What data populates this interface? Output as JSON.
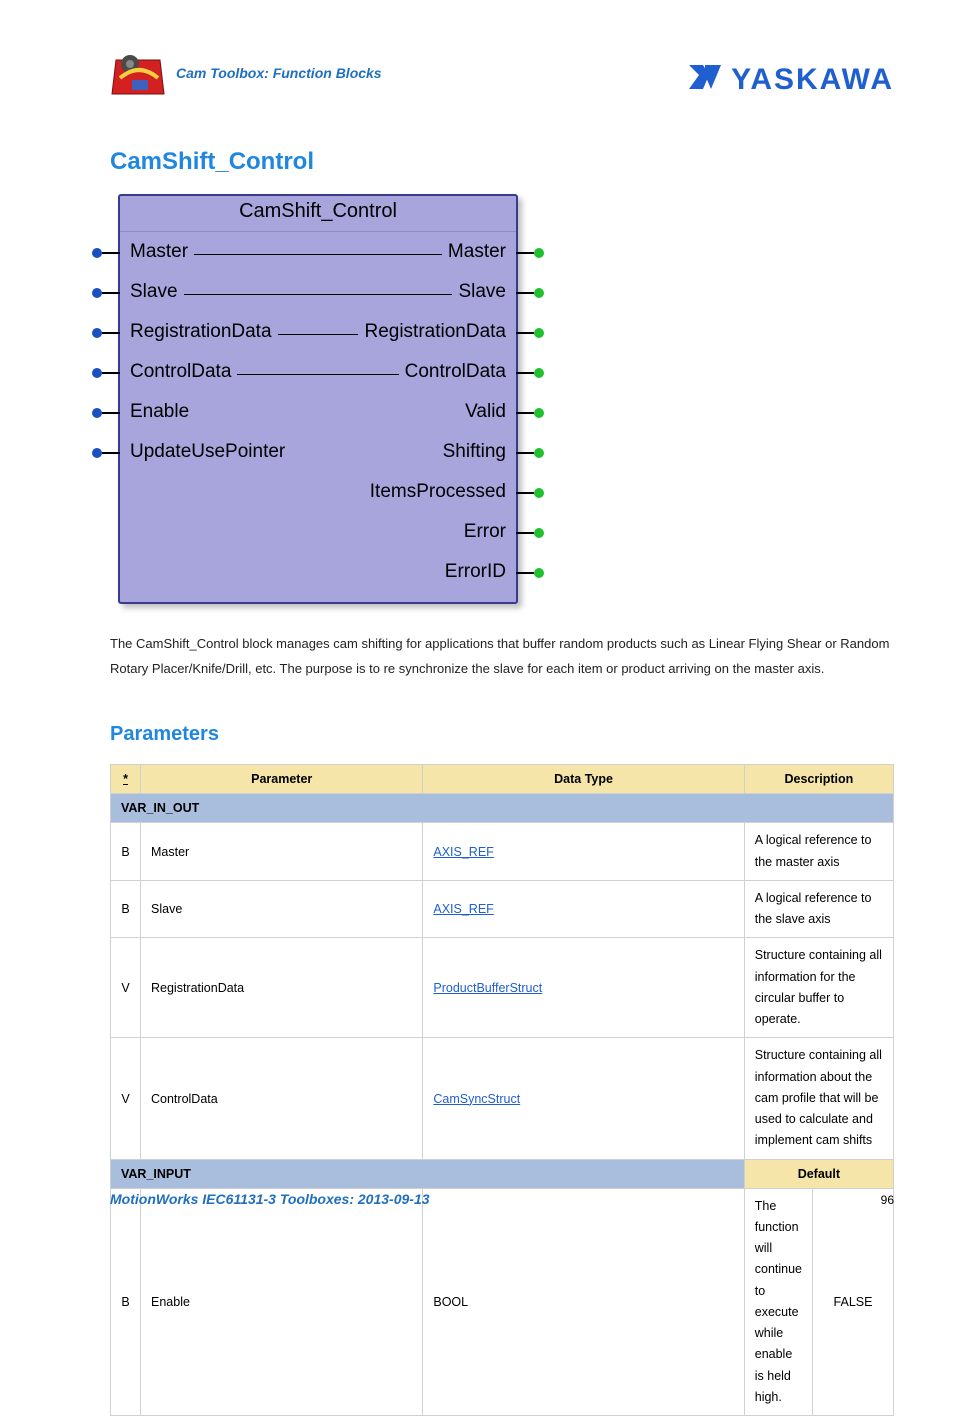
{
  "header": {
    "breadcrumb": "Cam Toolbox: Function Blocks",
    "brand_text": "YASKAWA"
  },
  "page_title": "CamShift_Control",
  "fb": {
    "title": "CamShift_Control",
    "rows": [
      {
        "left": "Master",
        "right": "Master",
        "dash": true,
        "pin_left": true,
        "pin_right": true
      },
      {
        "left": "Slave",
        "right": "Slave",
        "dash": true,
        "pin_left": true,
        "pin_right": true
      },
      {
        "left": "RegistrationData",
        "right": "RegistrationData",
        "dash": true,
        "pin_left": true,
        "pin_right": true
      },
      {
        "left": "ControlData",
        "right": "ControlData",
        "dash": true,
        "pin_left": true,
        "pin_right": true
      },
      {
        "left": "Enable",
        "right": "Valid",
        "dash": false,
        "pin_left": true,
        "pin_right": true
      },
      {
        "left": "UpdateUsePointer",
        "right": "Shifting",
        "dash": false,
        "pin_left": true,
        "pin_right": true
      },
      {
        "left": "",
        "right": "ItemsProcessed",
        "dash": false,
        "pin_left": false,
        "pin_right": true
      },
      {
        "left": "",
        "right": "Error",
        "dash": false,
        "pin_left": false,
        "pin_right": true
      },
      {
        "left": "",
        "right": "ErrorID",
        "dash": false,
        "pin_left": false,
        "pin_right": true
      }
    ]
  },
  "description": "The CamShift_Control block manages cam shifting for applications that buffer random products such as Linear Flying Shear or Random Rotary Placer/Knife/Drill, etc.  The purpose is to re synchronize the slave for each item or product arriving on the master axis.",
  "section_heading": "Parameters",
  "table": {
    "headers": {
      "star": "*",
      "param": "Parameter",
      "type": "Data Type",
      "desc": "Description",
      "default": "Default"
    },
    "groups": [
      {
        "label": "VAR_IN_OUT",
        "show_default": false,
        "rows": [
          {
            "star": "B",
            "param": "Master",
            "type": "AXIS_REF",
            "type_link": true,
            "desc": "A logical reference to the master axis",
            "default": ""
          },
          {
            "star": "B",
            "param": "Slave",
            "type": "AXIS_REF",
            "type_link": true,
            "desc": "A logical reference to the slave axis",
            "default": ""
          },
          {
            "star": "V",
            "param": "RegistrationData",
            "type": "ProductBufferStruct",
            "type_link": true,
            "desc": "Structure containing all information for the circular buffer to operate.",
            "default": ""
          },
          {
            "star": "V",
            "param": "ControlData",
            "type": "CamSyncStruct",
            "type_link": true,
            "desc": "Structure containing all information about the cam profile that will be used to calculate and implement cam shifts",
            "default": ""
          }
        ]
      },
      {
        "label": "VAR_INPUT",
        "show_default": true,
        "rows": [
          {
            "star": "B",
            "param": "Enable",
            "type": "BOOL",
            "type_link": false,
            "desc": "The function will continue to execute while enable is held high.",
            "default": "FALSE"
          }
        ]
      }
    ]
  },
  "footer": {
    "text": "MotionWorks IEC61131-3 Toolboxes: 2013-09-13",
    "page": "96"
  }
}
